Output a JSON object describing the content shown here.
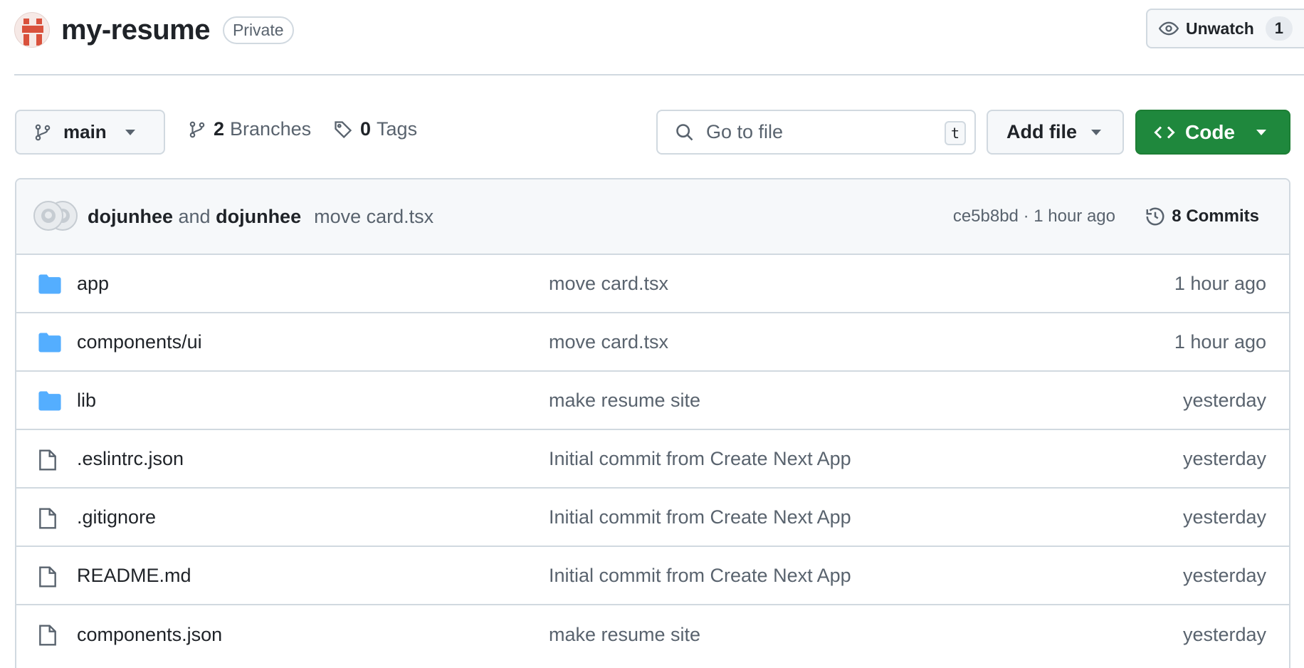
{
  "repo": {
    "name": "my-resume",
    "visibility": "Private",
    "avatar_icon": "identicon-avatar",
    "avatar_color": "#d9513c"
  },
  "watch": {
    "label": "Unwatch",
    "count": "1",
    "icon": "eye-icon"
  },
  "toolbar": {
    "branch": "main",
    "branches_count": "2",
    "branches_label": "Branches",
    "tags_count": "0",
    "tags_label": "Tags",
    "search_placeholder": "Go to file",
    "search_shortcut": "t",
    "add_file_label": "Add file",
    "code_label": "Code",
    "code_color": "#1f883d"
  },
  "latest_commit": {
    "author1": "dojunhee",
    "joiner": "and",
    "author2": "dojunhee",
    "message": "move card.tsx",
    "sha_time": "ce5b8bd · 1 hour ago",
    "commits_label": "8 Commits"
  },
  "files": [
    {
      "type": "folder",
      "name": "app",
      "message": "move card.tsx",
      "date": "1 hour ago"
    },
    {
      "type": "folder",
      "name": "components/ui",
      "message": "move card.tsx",
      "date": "1 hour ago"
    },
    {
      "type": "folder",
      "name": "lib",
      "message": "make resume site",
      "date": "yesterday"
    },
    {
      "type": "file",
      "name": ".eslintrc.json",
      "message": "Initial commit from Create Next App",
      "date": "yesterday"
    },
    {
      "type": "file",
      "name": ".gitignore",
      "message": "Initial commit from Create Next App",
      "date": "yesterday"
    },
    {
      "type": "file",
      "name": "README.md",
      "message": "Initial commit from Create Next App",
      "date": "yesterday"
    },
    {
      "type": "file",
      "name": "components.json",
      "message": "make resume site",
      "date": "yesterday"
    }
  ],
  "colors": {
    "folder": "#54aeff",
    "border": "#d1d9e0",
    "muted_text": "#59636e"
  }
}
